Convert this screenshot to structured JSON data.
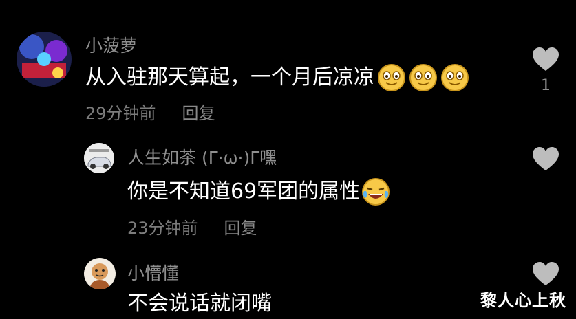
{
  "comments": [
    {
      "username": "小菠萝",
      "text": "从入驻那天算起，一个月后凉凉",
      "emojis": [
        "smile-emoji",
        "smile-emoji",
        "smile-emoji"
      ],
      "time": "29分钟前",
      "reply_label": "回复",
      "like_count": "1"
    },
    {
      "username": "人生如茶 (Γ·ω·)Γ嘿",
      "text": "你是不知道69军团的属性",
      "emojis": [
        "laugh-cry-emoji"
      ],
      "time": "23分钟前",
      "reply_label": "回复"
    },
    {
      "username": "小懵懂",
      "text": "不会说话就闭嘴"
    }
  ],
  "watermark": "黎人心上秋",
  "colors": {
    "background": "#000000",
    "username": "#8f8f8f",
    "text": "#ffffff",
    "meta": "#7c7c7c",
    "heart": "#bdbdbd",
    "emoji": "#f7c948"
  }
}
